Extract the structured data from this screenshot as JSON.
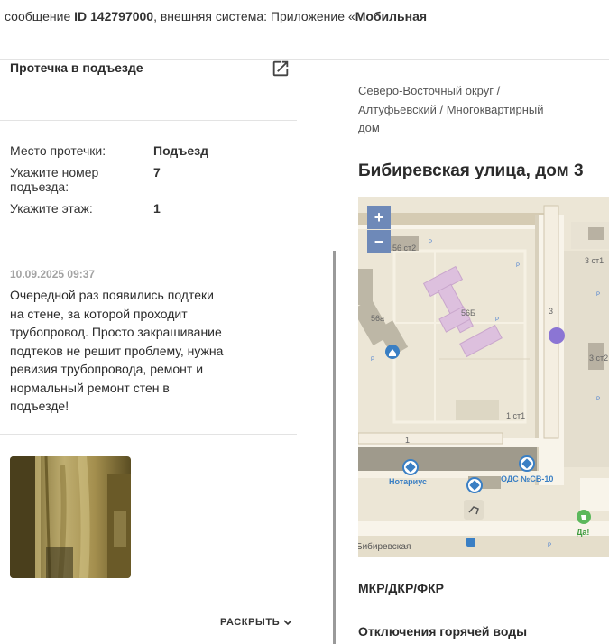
{
  "header": {
    "prefix": "сообщение ",
    "id_text": "ID 142797000",
    "middle": ", внешняя система: Приложение «",
    "system": "Мобильная"
  },
  "problem": {
    "title": "Протечка в подъезде",
    "open_icon": "external-link-icon"
  },
  "fields": [
    {
      "label": "Место протечки:",
      "value": "Подъезд"
    },
    {
      "label": "Укажите номер подъезда:",
      "value": "7"
    },
    {
      "label": "Укажите этаж:",
      "value": "1"
    }
  ],
  "comment": {
    "date": "10.09.2025 09:37",
    "text": "Очередной раз появились подтеки на стене, за которой проходит трубопровод. Просто закрашивание подтеков не решит проблему, нужна ревизия трубопровода, ремонт и нормальный ремонт стен в подъезде!"
  },
  "expand_label": "РАСКРЫТЬ",
  "location": {
    "breadcrumbs": "Северо-Восточный округ / Алтуфьевский / Многоквартирный дом",
    "address": "Бибиревская улица, дом 3"
  },
  "map": {
    "zoom_in": "+",
    "zoom_out": "−",
    "labels": {
      "b56st2": "56 ст2",
      "b56a": "56а",
      "b56b": "56Б",
      "b3": "3",
      "b3st1": "3 ст1",
      "b3st2": "3 ст2",
      "b1": "1",
      "b1st1": "1 ст1",
      "notarius": "Нотариус",
      "ods": "ОДС №СВ-10",
      "da": "Да!",
      "street": "Бибиревская",
      "p": "P"
    },
    "marker_color": "#8b75d4"
  },
  "sections": {
    "mkr": "МКР/ДКР/ФКР",
    "hot_water": "Отключения горячей воды"
  }
}
